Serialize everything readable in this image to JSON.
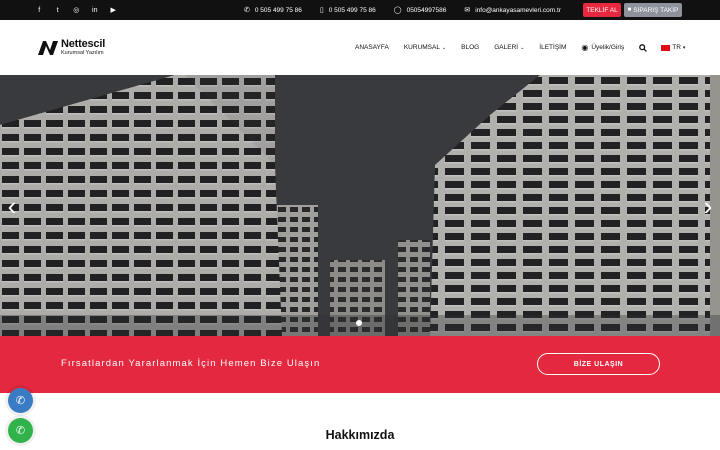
{
  "topbar": {
    "social": [
      {
        "icon": "facebook-icon",
        "glyph": "f"
      },
      {
        "icon": "twitter-icon",
        "glyph": "t"
      },
      {
        "icon": "instagram-icon",
        "glyph": "◎"
      },
      {
        "icon": "linkedin-icon",
        "glyph": "in"
      },
      {
        "icon": "youtube-icon",
        "glyph": "▶"
      }
    ],
    "phone1": "0 505 499 75 86",
    "phone2": "0 505 499 75 86",
    "whatsapp": "05054997586",
    "email": "info@ankayasamevleri.com.tr",
    "teklif_label": "TEKLİF AL",
    "siparis_label": "SİPARİŞ TAKİP"
  },
  "header": {
    "logo_brand": "Nettescil",
    "logo_sub": "Kurumsal Yazılım",
    "nav": {
      "home": "ANASAYFA",
      "corporate": "KURUMSAL",
      "blog": "BLOG",
      "gallery": "GALERİ",
      "contact": "İLETİŞİM",
      "login": "Üyelik/Giriş",
      "lang": "TR"
    }
  },
  "slider": {
    "prev": "‹",
    "next": "›",
    "active_index": 1,
    "count": 1
  },
  "cta": {
    "message": "Fırsatlardan Yararlanmak İçin Hemen Bize Ulaşın",
    "button": "BİZE ULAŞIN"
  },
  "about": {
    "title": "Hakkımızda"
  },
  "colors": {
    "accent_red": "#e3283f",
    "topbar": "#111111",
    "phone_button": "#3a7cc4",
    "whatsapp_button": "#2fb34a"
  }
}
